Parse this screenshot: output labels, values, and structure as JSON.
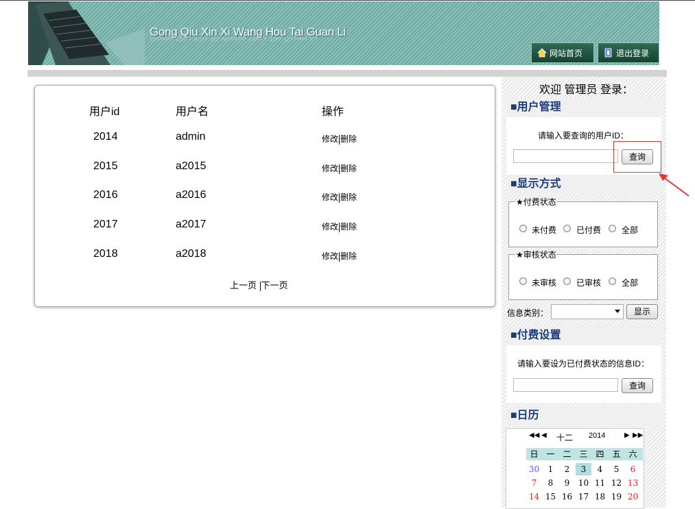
{
  "header": {
    "title": "Gong Qiu Xin Xi Wang Hou Tai Guan Li",
    "home_label": "网站首页",
    "logout_label": "退出登录"
  },
  "table": {
    "columns": [
      "用户id",
      "用户名",
      "操作"
    ],
    "rows": [
      {
        "id": "2014",
        "name": "admin"
      },
      {
        "id": "2015",
        "name": "a2015"
      },
      {
        "id": "2016",
        "name": "a2016"
      },
      {
        "id": "2017",
        "name": "a2017"
      },
      {
        "id": "2018",
        "name": "a2018"
      }
    ],
    "edit_label": "修改",
    "delete_label": "删除",
    "prev_label": "上一页",
    "next_label": "下一页"
  },
  "sidebar": {
    "welcome": "欢迎 管理员 登录：",
    "user_mgmt": {
      "title": "■用户管理",
      "prompt": "请输入要查询的用户ID：",
      "query_label": "查询"
    },
    "display": {
      "title": "■显示方式",
      "pay_status_legend": "★付费状态",
      "pay_options": [
        "未付费",
        "已付费",
        "全部"
      ],
      "review_status_legend": "★审核状态",
      "review_options": [
        "未审核",
        "已审核",
        "全部"
      ],
      "category_label": "信息类别：",
      "category_value": "",
      "show_label": "显示"
    },
    "pay_setting": {
      "title": "■付费设置",
      "prompt": "请输入要设为已付费状态的信息ID：",
      "query_label": "查询"
    },
    "calendar": {
      "title": "■日历",
      "month": "十二",
      "year": "2014",
      "weekdays": [
        "日",
        "一",
        "二",
        "三",
        "四",
        "五",
        "六"
      ],
      "weeks": [
        [
          "30",
          "1",
          "2",
          "3",
          "4",
          "5",
          "6"
        ],
        [
          "7",
          "8",
          "9",
          "10",
          "11",
          "12",
          "13"
        ],
        [
          "14",
          "15",
          "16",
          "17",
          "18",
          "19",
          "20"
        ]
      ],
      "today": "3"
    }
  },
  "colors": {
    "header_teal": "#7fb7b0",
    "section_title": "#1a3d7c",
    "annotation_red": "#e33333"
  }
}
